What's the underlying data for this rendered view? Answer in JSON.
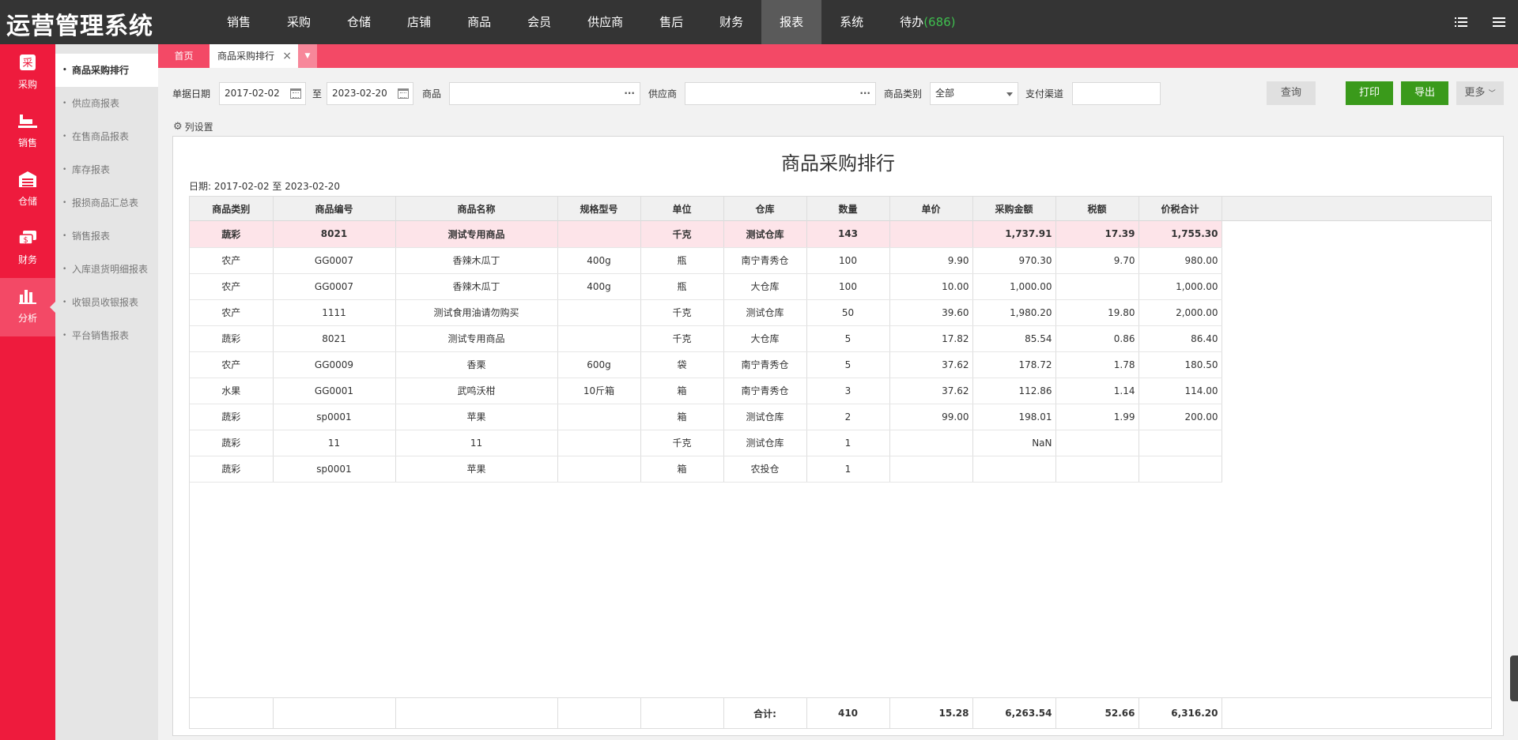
{
  "app": {
    "title": "运营管理系统"
  },
  "topnav": [
    {
      "label": "销售"
    },
    {
      "label": "采购"
    },
    {
      "label": "仓储"
    },
    {
      "label": "店铺"
    },
    {
      "label": "商品"
    },
    {
      "label": "会员"
    },
    {
      "label": "供应商"
    },
    {
      "label": "售后"
    },
    {
      "label": "财务"
    },
    {
      "label": "报表",
      "active": true
    },
    {
      "label": "系统"
    }
  ],
  "todo": {
    "label": "待办",
    "count": "(686)"
  },
  "leftnav": [
    {
      "label": "采购",
      "icon": "purchase-icon"
    },
    {
      "label": "销售",
      "icon": "sales-icon"
    },
    {
      "label": "仓储",
      "icon": "warehouse-icon"
    },
    {
      "label": "财务",
      "icon": "finance-icon"
    },
    {
      "label": "分析",
      "icon": "analysis-icon",
      "active": true
    }
  ],
  "submenu": [
    {
      "label": "商品采购排行",
      "active": true
    },
    {
      "label": "供应商报表"
    },
    {
      "label": "在售商品报表"
    },
    {
      "label": "库存报表"
    },
    {
      "label": "报损商品汇总表"
    },
    {
      "label": "销售报表"
    },
    {
      "label": "入库退货明细报表"
    },
    {
      "label": "收银员收银报表"
    },
    {
      "label": "平台销售报表"
    }
  ],
  "tabs": {
    "home": "首页",
    "current": "商品采购排行",
    "close": "×"
  },
  "filters": {
    "date_label": "单据日期",
    "date_from": "2017-02-02",
    "to": "至",
    "date_to": "2023-02-20",
    "product_label": "商品",
    "product_value": "",
    "supplier_label": "供应商",
    "supplier_value": "",
    "category_label": "商品类别",
    "category_value": "全部",
    "channel_label": "支付渠道",
    "channel_value": "",
    "ellipsis": "···"
  },
  "buttons": {
    "query": "查询",
    "print": "打印",
    "export": "导出",
    "more": "更多"
  },
  "colset": {
    "label": "列设置"
  },
  "report": {
    "title": "商品采购排行",
    "date_range": "日期: 2017-02-02 至 2023-02-20",
    "columns": [
      "商品类别",
      "商品编号",
      "商品名称",
      "规格型号",
      "单位",
      "仓库",
      "数量",
      "单价",
      "采购金额",
      "税额",
      "价税合计"
    ],
    "rows": [
      [
        "蔬彩",
        "8021",
        "测试专用商品",
        "",
        "千克",
        "测试仓库",
        "143",
        "",
        "1,737.91",
        "17.39",
        "1,755.30"
      ],
      [
        "农产",
        "GG0007",
        "香辣木瓜丁",
        "400g",
        "瓶",
        "南宁青秀仓",
        "100",
        "9.90",
        "970.30",
        "9.70",
        "980.00"
      ],
      [
        "农产",
        "GG0007",
        "香辣木瓜丁",
        "400g",
        "瓶",
        "大仓库",
        "100",
        "10.00",
        "1,000.00",
        "",
        "1,000.00"
      ],
      [
        "农产",
        "1111",
        "测试食用油请勿购买",
        "",
        "千克",
        "测试仓库",
        "50",
        "39.60",
        "1,980.20",
        "19.80",
        "2,000.00"
      ],
      [
        "蔬彩",
        "8021",
        "测试专用商品",
        "",
        "千克",
        "大仓库",
        "5",
        "17.82",
        "85.54",
        "0.86",
        "86.40"
      ],
      [
        "农产",
        "GG0009",
        "香栗",
        "600g",
        "袋",
        "南宁青秀仓",
        "5",
        "37.62",
        "178.72",
        "1.78",
        "180.50"
      ],
      [
        "水果",
        "GG0001",
        "武鸣沃柑",
        "10斤箱",
        "箱",
        "南宁青秀仓",
        "3",
        "37.62",
        "112.86",
        "1.14",
        "114.00"
      ],
      [
        "蔬彩",
        "sp0001",
        "苹果",
        "",
        "箱",
        "测试仓库",
        "2",
        "99.00",
        "198.01",
        "1.99",
        "200.00"
      ],
      [
        "蔬彩",
        "11",
        "11",
        "",
        "千克",
        "测试仓库",
        "1",
        "",
        "NaN",
        "",
        ""
      ],
      [
        "蔬彩",
        "sp0001",
        "苹果",
        "",
        "箱",
        "农投仓",
        "1",
        "",
        "",
        "",
        ""
      ]
    ],
    "totals": {
      "label": "合计:",
      "qty": "410",
      "price": "15.28",
      "amount": "6,263.54",
      "tax": "52.66",
      "total": "6,316.20"
    }
  }
}
